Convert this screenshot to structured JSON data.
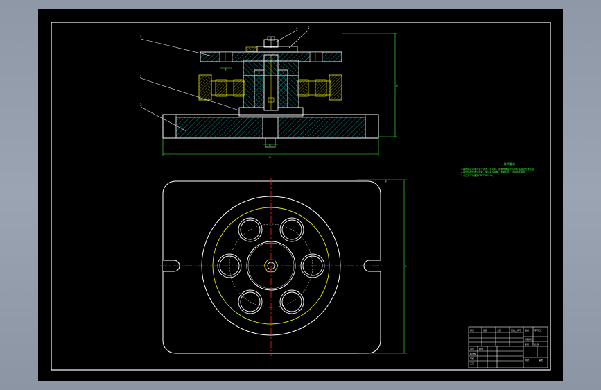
{
  "app": "CAD drawing viewer",
  "drawing": {
    "part_labels": [
      "1",
      "2",
      "3",
      "4",
      "5"
    ],
    "dimension_labels": [
      "φ",
      "φ",
      "φ",
      "φ",
      "φ",
      "φ"
    ],
    "tech_requirements": {
      "title": "技术要求",
      "lines": [
        "1.装配前应对零件进行清洗，去毛刺，各零件表面不允许有磕碰划伤等缺陷。",
        "2.装配后检查各连接处，保证定位准确，夹紧可靠，符合图样要求。",
        "3.未注尺寸公差按GB/T1804-m。"
      ]
    },
    "title_block": {
      "cells": [
        "标记",
        "处数",
        "分区",
        "更改文件号",
        "签名",
        "年月日",
        "设计",
        "标准化",
        "审核",
        "工艺",
        "批准",
        "阶段标记",
        "重量",
        "比例",
        "共张",
        "第张"
      ]
    },
    "colors": {
      "background": "#000000",
      "outline": "#ffffff",
      "hatch": "#00c8c8",
      "dimension": "#3cff3c",
      "centerline": "#ff2020",
      "pitch_circle": "#e6e600",
      "border": "#ffffff"
    }
  }
}
